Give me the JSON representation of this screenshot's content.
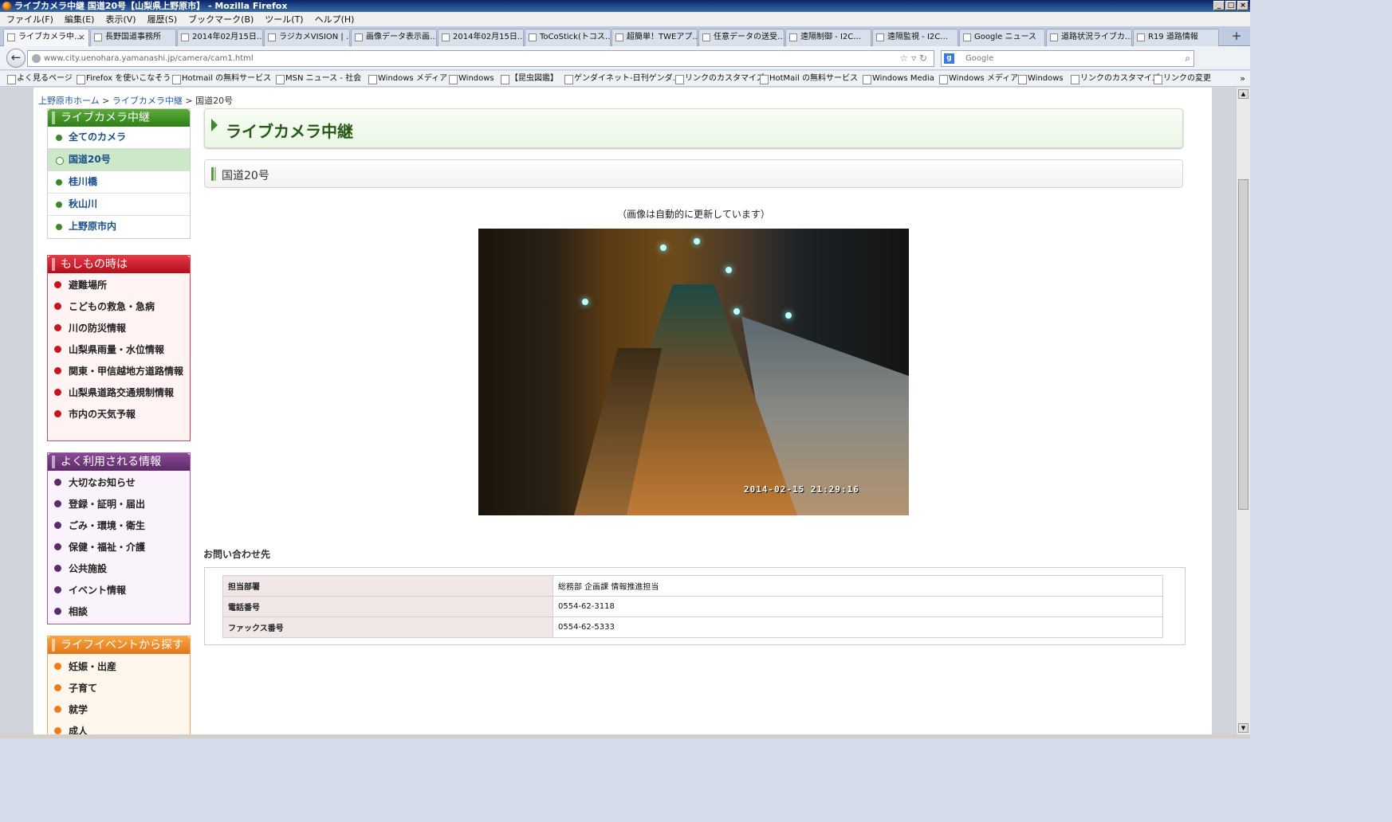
{
  "window": {
    "title": "ライブカメラ中継 国道20号【山梨県上野原市】 - Mozilla Firefox"
  },
  "menu": [
    "ファイル(F)",
    "編集(E)",
    "表示(V)",
    "履歴(S)",
    "ブックマーク(B)",
    "ツール(T)",
    "ヘルプ(H)"
  ],
  "tabs": [
    {
      "label": "ライブカメラ中…"
    },
    {
      "label": "長野国道事務所"
    },
    {
      "label": "2014年02月15日…"
    },
    {
      "label": "ラジカメVISION | …"
    },
    {
      "label": "画像データ表示画…"
    },
    {
      "label": "2014年02月15日…"
    },
    {
      "label": "ToCoStick(トコス…"
    },
    {
      "label": "超簡単！TWEアプ…"
    },
    {
      "label": "任意データの送受…"
    },
    {
      "label": "遠隔制御 - I2C…"
    },
    {
      "label": "遠隔監視 - I2C…"
    },
    {
      "label": "Google ニュース"
    },
    {
      "label": "道路状況ライブカ…"
    },
    {
      "label": "R19 道路情報"
    }
  ],
  "nav": {
    "url": "www.city.uenohara.yamanashi.jp/camera/cam1.html",
    "search_placeholder": "Google"
  },
  "bookmarks": [
    "よく見るページ",
    "Firefox を使いこなそう",
    "Hotmail の無料サービス",
    "MSN ニュース - 社会",
    "Windows メディア",
    "Windows",
    "【昆虫図鑑】",
    "ゲンダイネット-日刊ゲンダ…",
    "リンクのカスタマイズ",
    "HotMail の無料サービス",
    "Windows Media",
    "Windows メディア",
    "Windows",
    "リンクのカスタマイズ",
    "リンクの変更"
  ],
  "breadcrumb": {
    "home": "上野原市ホーム",
    "section": "ライブカメラ中継",
    "current": "国道20号",
    "sep": ">"
  },
  "sidebar": {
    "camera": {
      "title": "ライブカメラ中継",
      "items": [
        "全てのカメラ",
        "国道20号",
        "桂川橋",
        "秋山川",
        "上野原市内"
      ],
      "selected": 1
    },
    "emergency": {
      "title": "もしもの時は",
      "items": [
        "避難場所",
        "こどもの救急・急病",
        "川の防災情報",
        "山梨県雨量・水位情報",
        "関東・甲信越地方道路情報",
        "山梨県道路交通規制情報",
        "市内の天気予報"
      ]
    },
    "popular": {
      "title": "よく利用される情報",
      "items": [
        "大切なお知らせ",
        "登録・証明・届出",
        "ごみ・環境・衛生",
        "保健・福祉・介護",
        "公共施設",
        "イベント情報",
        "相談"
      ]
    },
    "life": {
      "title": "ライフイベントから探す",
      "items": [
        "妊娠・出産",
        "子育て",
        "就学",
        "成人"
      ]
    }
  },
  "main": {
    "title": "ライブカメラ中継",
    "subtitle": "国道20号",
    "note": "（画像は自動的に更新しています）",
    "camera_timestamp": "2014-02-15 21:29:16",
    "contact_title": "お問い合わせ先",
    "contact": [
      {
        "key": "担当部署",
        "value": "総務部 企画課 情報推進担当"
      },
      {
        "key": "電話番号",
        "value": "0554-62-3118"
      },
      {
        "key": "ファックス番号",
        "value": "0554-62-5333"
      }
    ]
  }
}
